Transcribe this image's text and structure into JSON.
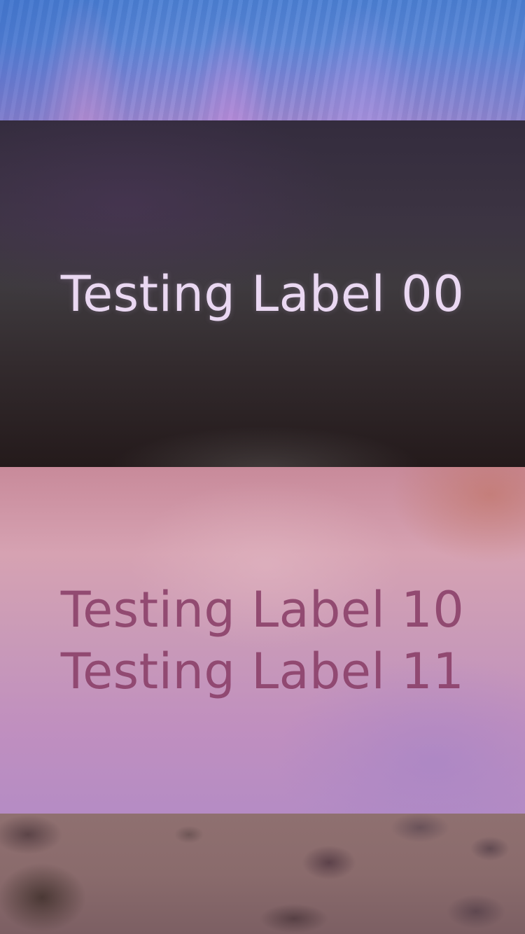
{
  "screen": {
    "labels": {
      "top_panel": [
        "Testing Label 00"
      ],
      "bottom_panel": [
        "Testing Label 10",
        "Testing Label 11"
      ]
    }
  },
  "colors": {
    "light_label": "#ead8f2",
    "dark_label": "#8a3f68"
  }
}
